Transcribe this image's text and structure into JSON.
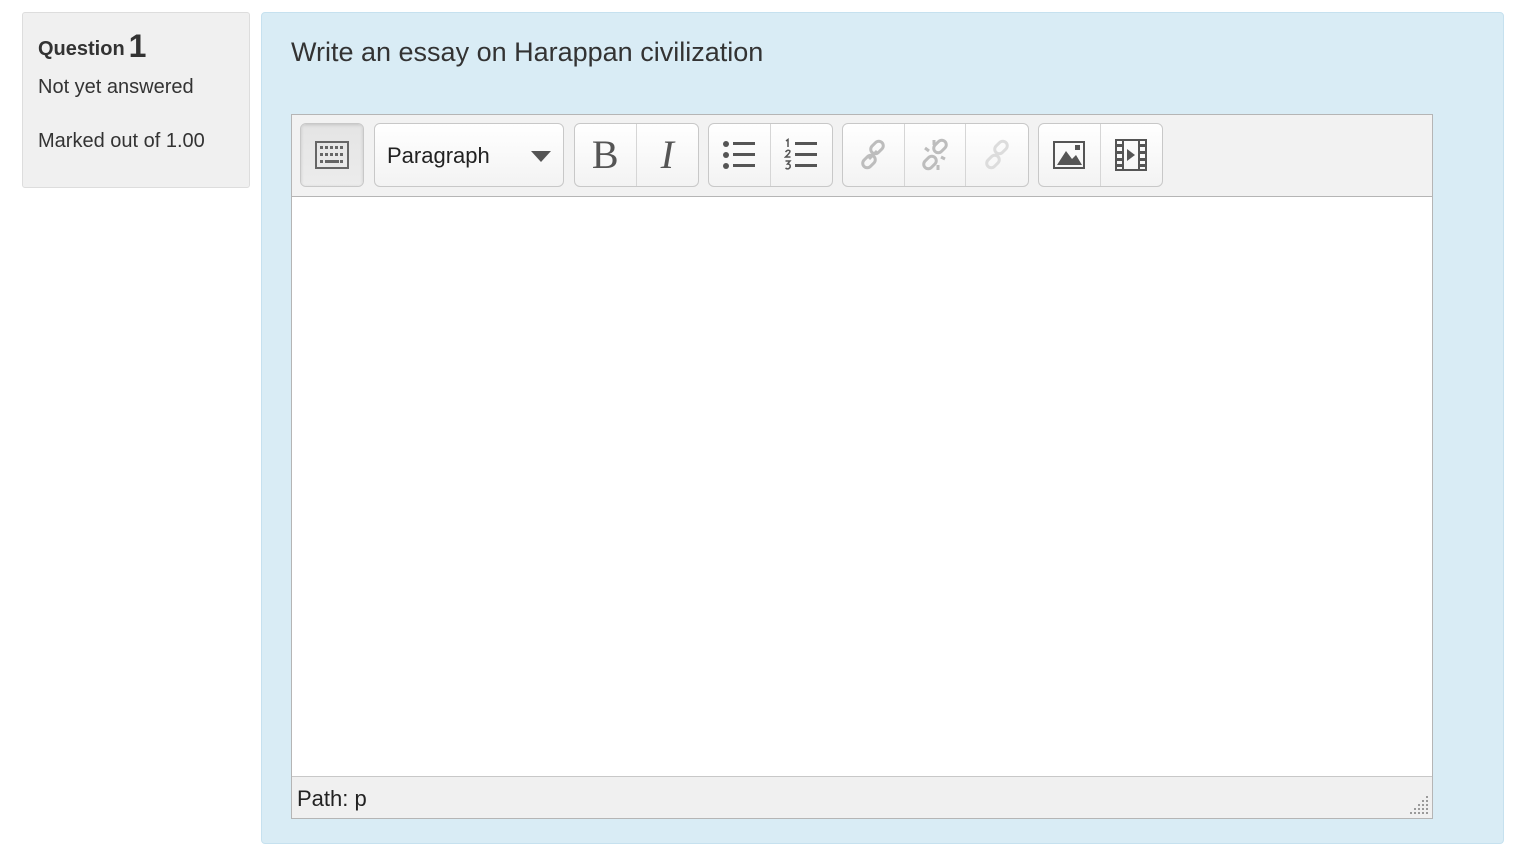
{
  "info": {
    "question_word": "Question",
    "question_number": "1",
    "state": "Not yet answered",
    "grade": "Marked out of 1.00"
  },
  "question": {
    "text": "Write an essay on Harappan civilization"
  },
  "editor": {
    "toolbar": {
      "toolbar_toggle_icon": "keyboard-grid-icon",
      "format_select": {
        "selected": "Paragraph"
      },
      "bold_label": "B",
      "italic_label": "I",
      "buttons": [
        {
          "name": "bullet-list",
          "icon": "bullet-list-icon",
          "enabled": true
        },
        {
          "name": "numbered-list",
          "icon": "numbered-list-icon",
          "enabled": true
        },
        {
          "name": "insert-link",
          "icon": "link-icon",
          "enabled": false
        },
        {
          "name": "unlink",
          "icon": "unlink-icon",
          "enabled": false
        },
        {
          "name": "anchor",
          "icon": "anchor-link-icon",
          "enabled": false
        },
        {
          "name": "insert-image",
          "icon": "image-icon",
          "enabled": true
        },
        {
          "name": "insert-media",
          "icon": "film-icon",
          "enabled": true
        }
      ]
    },
    "content": "",
    "status": {
      "path": "Path: p"
    }
  },
  "colors": {
    "content_background": "#d9ecf5",
    "info_background": "#f0f0f0",
    "toolbar_background": "#f2f2f2",
    "text": "#333333"
  }
}
